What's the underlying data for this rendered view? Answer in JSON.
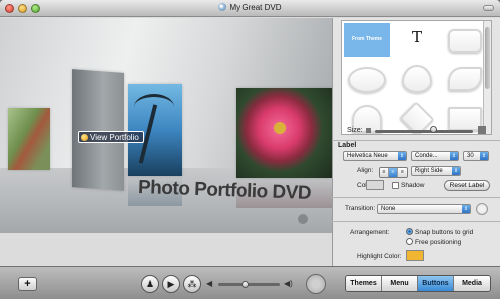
{
  "window": {
    "title": "My Great DVD"
  },
  "preview": {
    "menu_title": "Photo Portfolio DVD",
    "button_label": "View Portfolio"
  },
  "inspector": {
    "shapes": {
      "selected_label": "From Theme",
      "text_glyph": "T"
    },
    "size_label": "Size:",
    "size_value": 0.6,
    "label_section": "Label",
    "font_family": "Helvetica Neue",
    "font_style": "Conde...",
    "font_size": "30",
    "align_label": "Align:",
    "align_position": "Right Side",
    "color_label": "Color:",
    "shadow_label": "Shadow",
    "reset_label": "Reset Label",
    "transition_label": "Transition:",
    "transition_value": "None",
    "arrangement_label": "Arrangement:",
    "snap_label": "Snap buttons to grid",
    "free_label": "Free positioning",
    "highlight_label": "Highlight Color:"
  },
  "colors": {
    "highlight": "#f0b632",
    "label_color": "#d9d9d9",
    "accent": "#3a8ad6"
  },
  "toolbar": {
    "add_label": "+",
    "volume_value": 0.45,
    "tabs": [
      "Themes",
      "Menu",
      "Buttons",
      "Media"
    ],
    "active_tab": "Buttons"
  }
}
